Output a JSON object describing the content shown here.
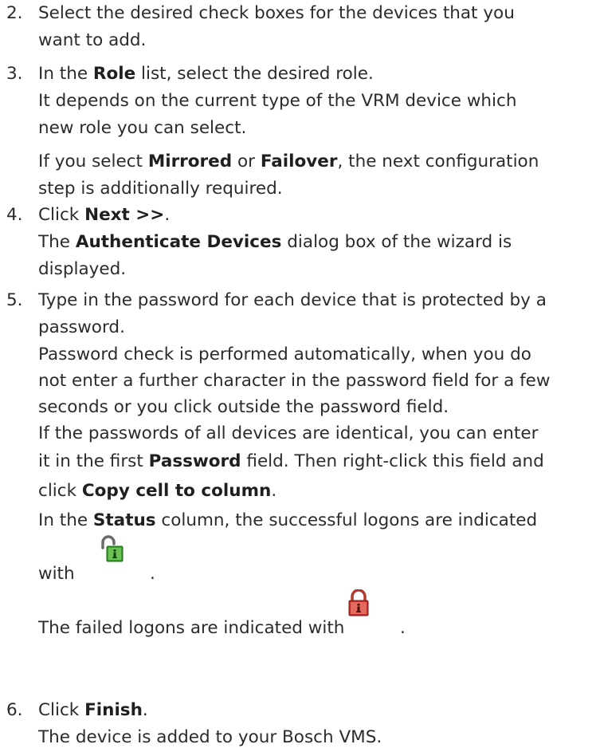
{
  "steps": [
    {
      "number": "2.",
      "lines": [
        "Select the desired check boxes for the devices that you",
        "want to add."
      ]
    },
    {
      "number": "3.",
      "line1": {
        "pre": "In the ",
        "b": "Role",
        "post": " list, select the desired role."
      },
      "line2": "It depends on the current type of the VRM device which",
      "line3": "new role you can select.",
      "line4": {
        "pre": "If you select ",
        "b1": "Mirrored",
        "mid": " or ",
        "b2": "Failover",
        "post": ", the next configuration"
      },
      "line5": "step is additionally required."
    },
    {
      "number": "4.",
      "line1": {
        "pre": "Click ",
        "b": "Next >>",
        "post": "."
      },
      "line2": {
        "pre": "The ",
        "b": "Authenticate Devices",
        "post": " dialog box of the wizard is"
      },
      "line3": "displayed."
    },
    {
      "number": "5.",
      "line1": "Type in the password for each device that is protected by a",
      "line2": "password.",
      "line3": "Password check is performed automatically, when you do",
      "line4": "not enter a further character in the password field for a few",
      "line5": "seconds or you click outside the password field.",
      "line6": "If the passwords of all devices are identical, you can enter",
      "line7": {
        "pre": "it in the first ",
        "b": "Password",
        "post": " field. Then right-click this field and"
      },
      "line8": {
        "pre": "click ",
        "b": "Copy cell to column",
        "post": "."
      },
      "line9": {
        "pre": "In the ",
        "b": "Status",
        "post": " column, the successful logons are indicated"
      },
      "line10": {
        "pre": "with",
        "post": "."
      },
      "line11": {
        "pre": "The failed logons are indicated with",
        "post": "."
      }
    },
    {
      "number": "6.",
      "line1": {
        "pre": "Click ",
        "b": "Finish",
        "post": "."
      },
      "line2": "The device is added to your Bosch VMS."
    }
  ],
  "icons": {
    "success": "unlocked-padlock-icon",
    "failure": "locked-padlock-icon"
  },
  "colors": {
    "text": "#2b2b2b",
    "success_icon": "#3a9a2c",
    "failure_icon": "#c0302a"
  }
}
